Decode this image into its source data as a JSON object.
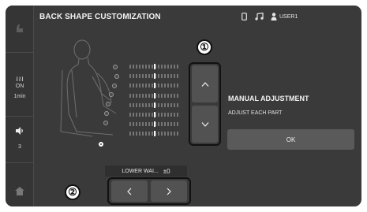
{
  "header": {
    "title": "BACK SHAPE CUSTOMIZATION",
    "user_label": "USER1",
    "status_icons": [
      "phone-icon",
      "music-note-icon",
      "user-icon"
    ]
  },
  "sidebar": {
    "top_icon": "seat-icon",
    "heater": {
      "icon": "seat-heater-icon",
      "state": "ON",
      "time": "1min"
    },
    "fan": {
      "icon": "fan-icon",
      "level": "3"
    },
    "home_icon": "home-icon"
  },
  "seat": {
    "figure_icon": "seated-person-icon",
    "zone_count": 8,
    "selected_zone_index": 7,
    "zone_levels": [
      0,
      0,
      0,
      0,
      0,
      0,
      0,
      0
    ],
    "level_range": [
      -5,
      5
    ]
  },
  "adjust": {
    "up_icon": "chevron-up-icon",
    "down_icon": "chevron-down-icon",
    "left_icon": "chevron-left-icon",
    "right_icon": "chevron-right-icon",
    "callout_1": "①",
    "callout_2": "②"
  },
  "selection": {
    "label": "LOWER WAI...",
    "value": "±0"
  },
  "panel": {
    "title": "MANUAL ADJUSTMENT",
    "subtitle": "ADJUST EACH PART",
    "ok_label": "OK"
  },
  "colors": {
    "screen_bg": "#3a3a3a",
    "button_bg": "#525252",
    "marker": "#f5f5f5",
    "frame": "#111111"
  }
}
